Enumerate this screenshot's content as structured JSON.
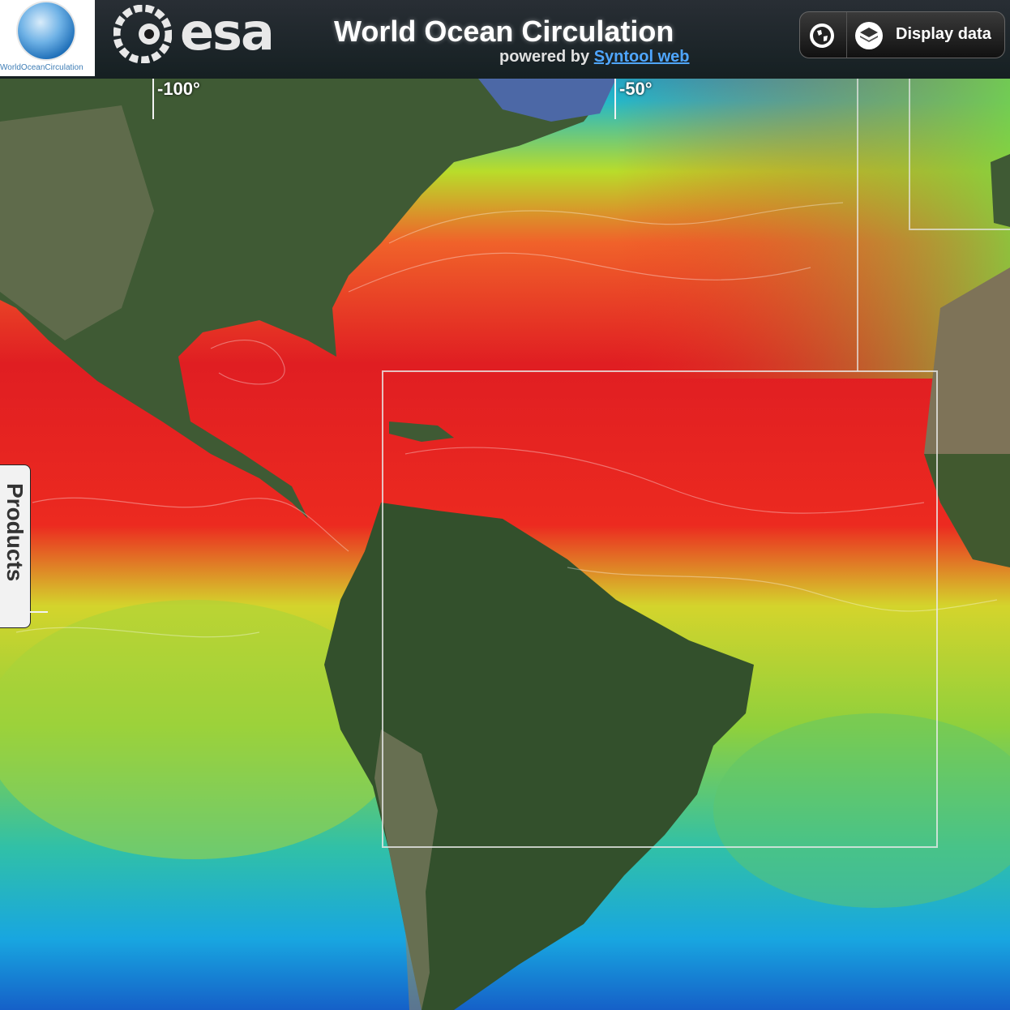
{
  "header": {
    "logo_caption": "WorldOceanCirculation",
    "agency_name": "esa",
    "title": "World Ocean Circulation",
    "powered_prefix": "powered by",
    "powered_link": "Syntool web"
  },
  "toolbar": {
    "globe_icon": "globe-icon",
    "layers_icon": "layers-icon",
    "display_data_label": "Display data"
  },
  "map": {
    "longitude_labels": [
      "-100°",
      "-50°"
    ],
    "colors": {
      "deep": "#0a2a8a",
      "cool": "#1fb0d8",
      "mild": "#7cd04a",
      "warm": "#e8e030",
      "hot": "#f03a20",
      "hottest": "#c0101c",
      "land": "#3a5230"
    }
  },
  "sidebar": {
    "products_label": "Products"
  }
}
